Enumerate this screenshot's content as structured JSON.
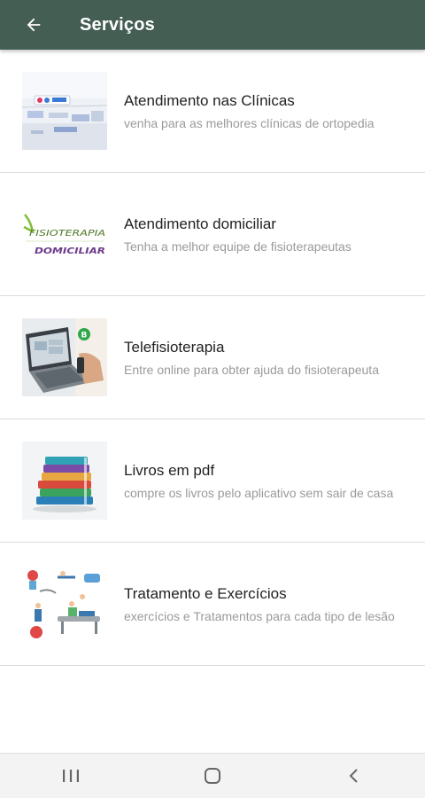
{
  "appbar": {
    "title": "Serviços",
    "background": "#445e54",
    "back_icon": "arrow-left-icon"
  },
  "services": [
    {
      "title": "Atendimento nas Clínicas",
      "subtitle": "venha para as melhores clínicas de ortopedia",
      "thumbnail_icon": "clinic-photo"
    },
    {
      "title": "Atendimento domiciliar",
      "subtitle": "Tenha a melhor equipe de fisioterapeutas",
      "thumbnail_icon": "fisioterapia-domiciliar-logo",
      "thumbnail_text": [
        "FISIOTERAPIA",
        "DOMICILIAR"
      ]
    },
    {
      "title": "Telefisioterapia",
      "subtitle": "Entre online para obter ajuda do fisioterapeuta",
      "thumbnail_icon": "laptop-photo"
    },
    {
      "title": "Livros em pdf",
      "subtitle": "compre os livros pelo aplicativo sem sair de casa",
      "thumbnail_icon": "books-stack-image"
    },
    {
      "title": "Tratamento e Exercícios",
      "subtitle": "exercícios e Tratamentos para cada tipo de lesão",
      "thumbnail_icon": "exercise-illustration"
    }
  ],
  "navbar": {
    "recents_icon": "recents-icon",
    "home_icon": "home-icon",
    "back_icon": "nav-back-icon"
  }
}
